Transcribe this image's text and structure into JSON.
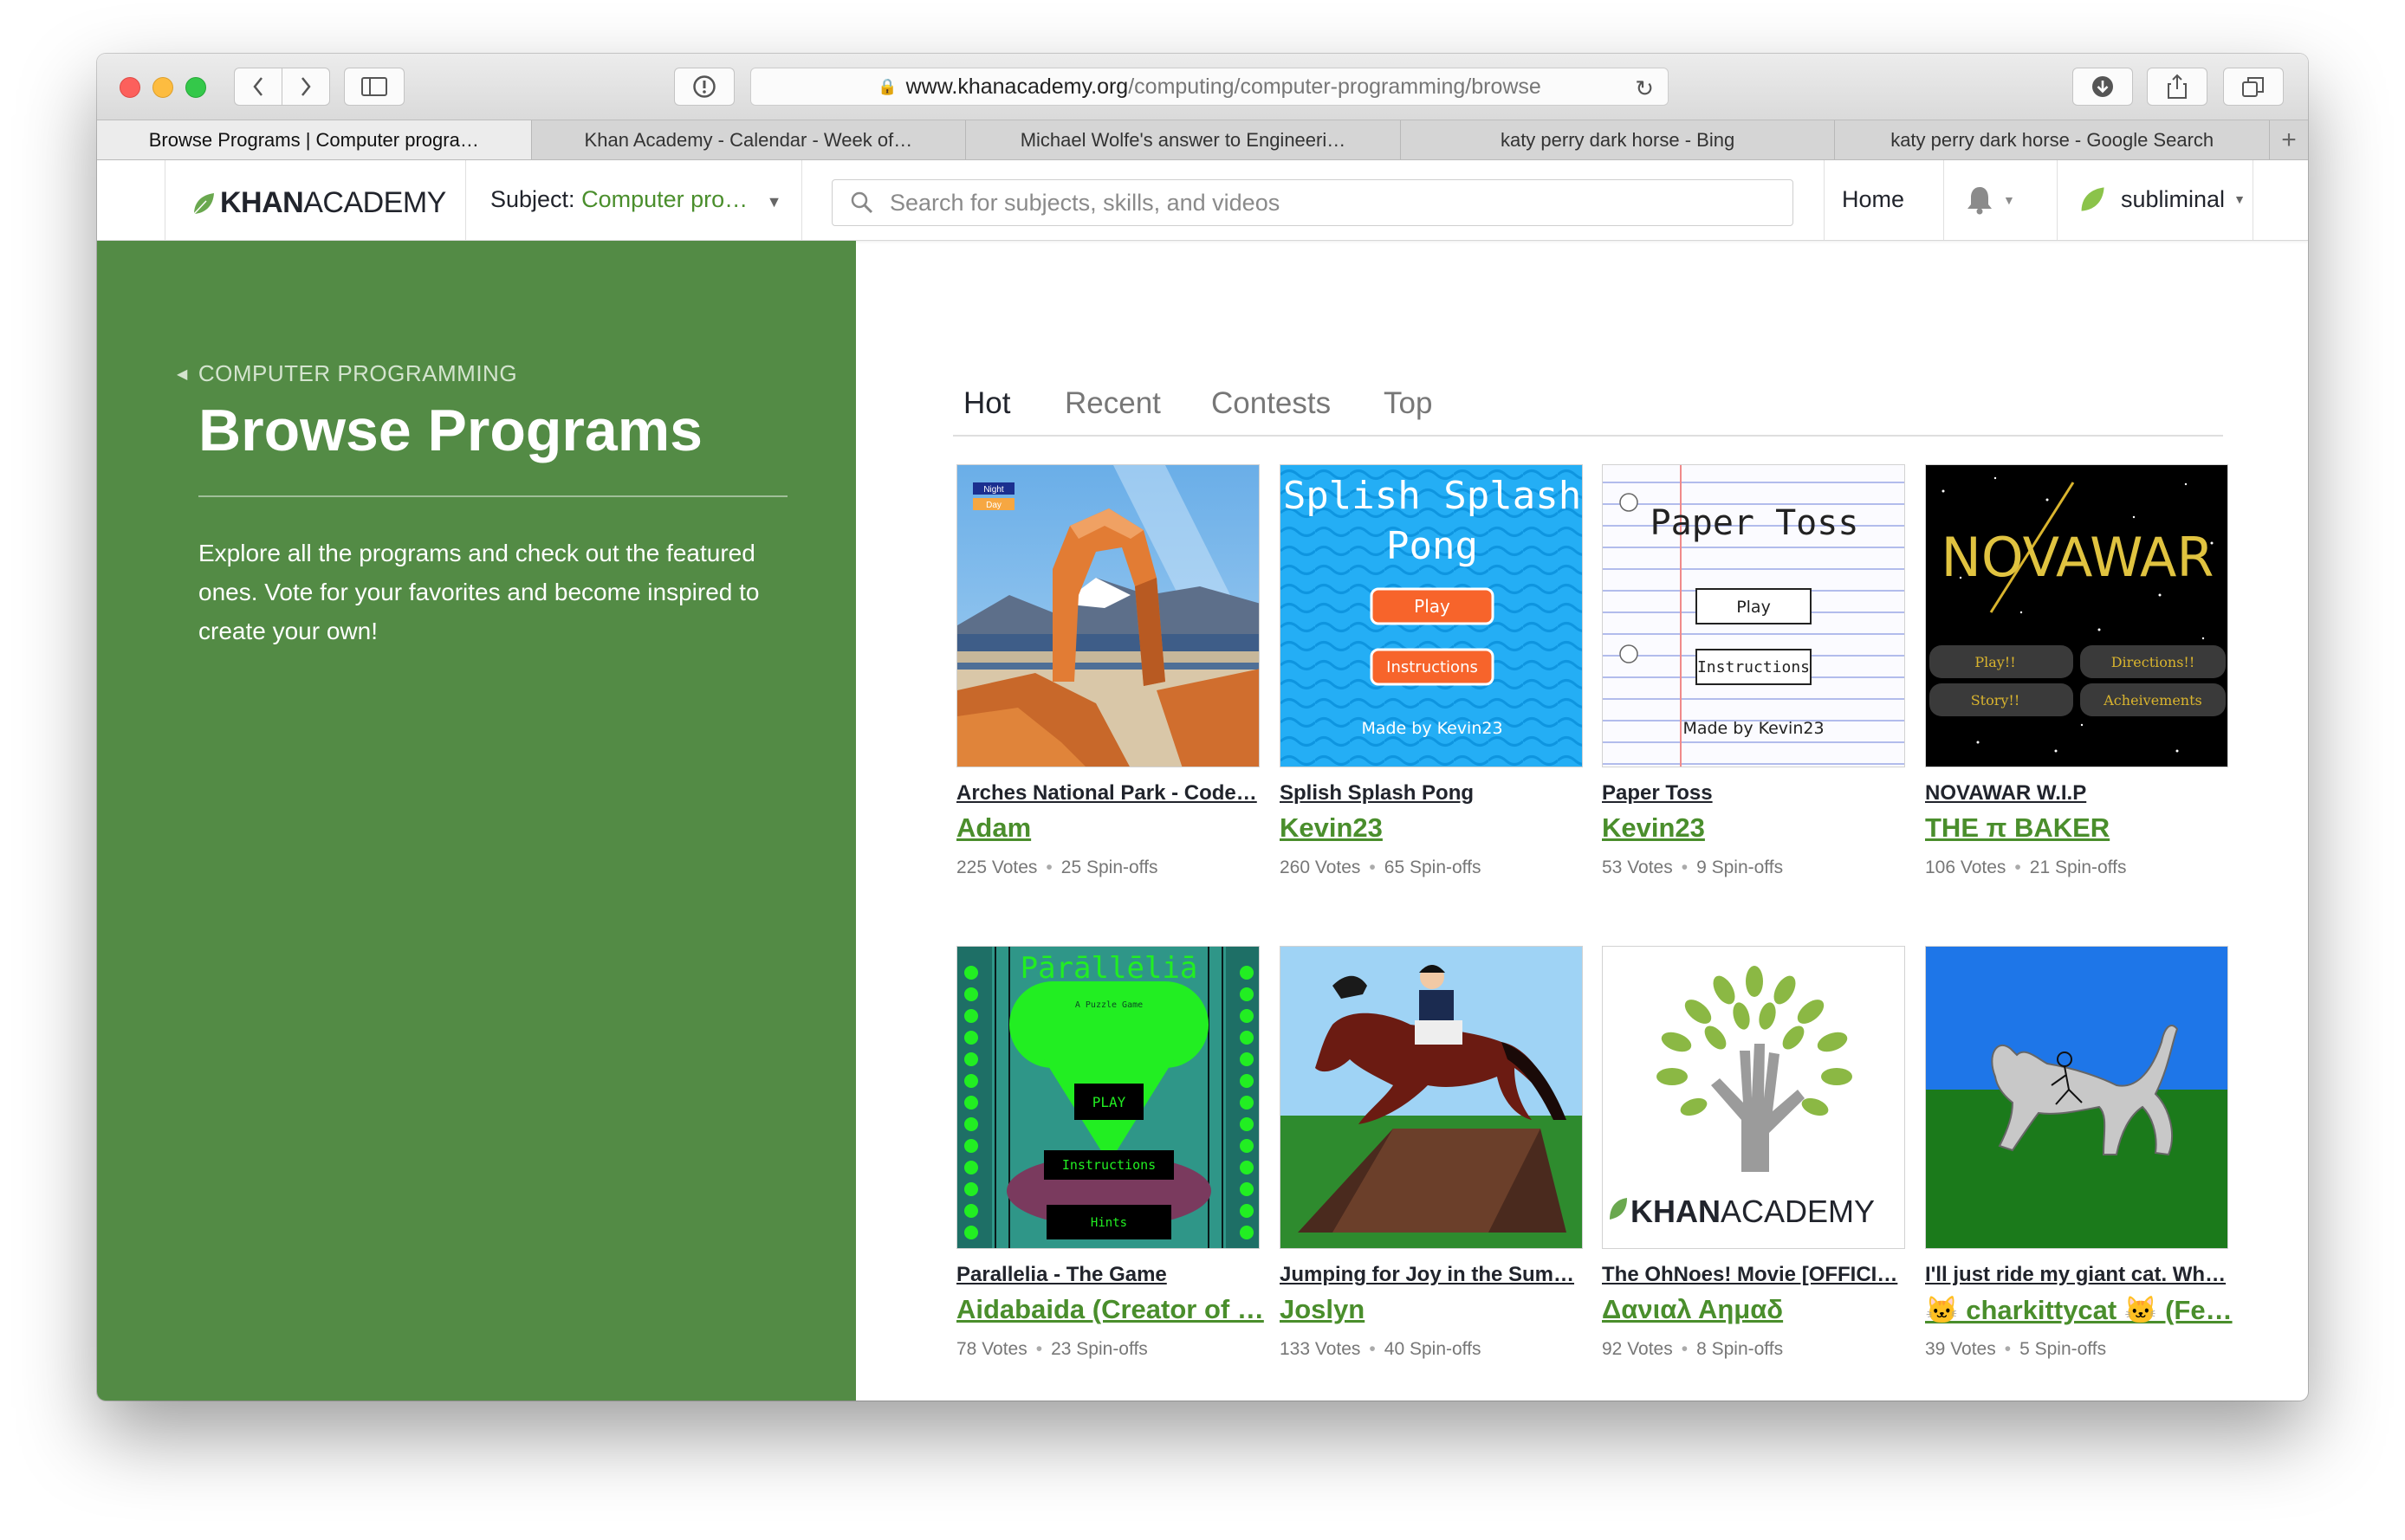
{
  "browser": {
    "url_domain": "www.khanacademy.org",
    "url_path": "/computing/computer-programming/browse",
    "tabs": [
      {
        "label": "Browse Programs | Computer progra…"
      },
      {
        "label": "Khan Academy - Calendar - Week of…"
      },
      {
        "label": "Michael Wolfe's answer to Engineeri…"
      },
      {
        "label": "katy perry dark horse - Bing"
      },
      {
        "label": "katy perry dark horse - Google Search"
      }
    ]
  },
  "header": {
    "logo_bold": "KHAN",
    "logo_rest": "ACADEMY",
    "subject_label": "Subject:",
    "subject_value": "Computer pro…",
    "search_placeholder": "Search for subjects, skills, and videos",
    "home": "Home",
    "username": "subliminal"
  },
  "sidebar": {
    "breadcrumb": "COMPUTER PROGRAMMING",
    "title": "Browse Programs",
    "description": "Explore all the programs and check out the featured ones. Vote for your favorites and become inspired to create your own!"
  },
  "main": {
    "tabs": [
      "Hot",
      "Recent",
      "Contests",
      "Top"
    ],
    "programs": [
      {
        "title": "Arches National Park - Code…",
        "author": "Adam",
        "votes": "225 Votes",
        "spinoffs": "25 Spin-offs"
      },
      {
        "title": "Splish Splash Pong",
        "author": "Kevin23",
        "votes": "260 Votes",
        "spinoffs": "65 Spin-offs"
      },
      {
        "title": "Paper Toss",
        "author": "Kevin23",
        "votes": "53 Votes",
        "spinoffs": "9 Spin-offs"
      },
      {
        "title": "NOVAWAR W.I.P",
        "author": "THE π BAKER",
        "votes": "106 Votes",
        "spinoffs": "21 Spin-offs"
      },
      {
        "title": "Parallelia - The Game",
        "author": "Aidabaida (Creator of …",
        "votes": "78 Votes",
        "spinoffs": "23 Spin-offs"
      },
      {
        "title": "Jumping for Joy in the Sum…",
        "author": "Joslyn",
        "votes": "133 Votes",
        "spinoffs": "40 Spin-offs"
      },
      {
        "title": "The OhNoes! Movie [OFFICI…",
        "author": "Δανιαλ Αημαδ",
        "votes": "92 Votes",
        "spinoffs": "8 Spin-offs"
      },
      {
        "title": "I'll just ride my giant cat. Wh…",
        "author": "🐱 charkittycat 🐱 (Fe…",
        "votes": "39 Votes",
        "spinoffs": "5 Spin-offs"
      }
    ]
  },
  "thumbs": {
    "arches": {
      "night": "Night",
      "day": "Day"
    },
    "pong": {
      "line1": "Splish Splash",
      "line2": "Pong",
      "play": "Play",
      "instructions": "Instructions",
      "credit": "Made by Kevin23"
    },
    "toss": {
      "title": "Paper Toss",
      "play": "Play",
      "instructions": "Instructions",
      "credit": "Made by Kevin23"
    },
    "nova": {
      "title": "NOVAWAR",
      "b1": "Play!!",
      "b2": "Directions!!",
      "b3": "Story!!",
      "b4": "Acheivements"
    },
    "para": {
      "title": "Pārāllēliā",
      "sub": "A Puzzle Game",
      "play": "PLAY",
      "instructions": "Instructions",
      "hints": "Hints"
    },
    "ohnoes": {
      "logo_bold": "KHAN",
      "logo_rest": "ACADEMY"
    }
  },
  "colors": {
    "sidebar": "#538b45",
    "brand_green": "#4a8e2c"
  }
}
